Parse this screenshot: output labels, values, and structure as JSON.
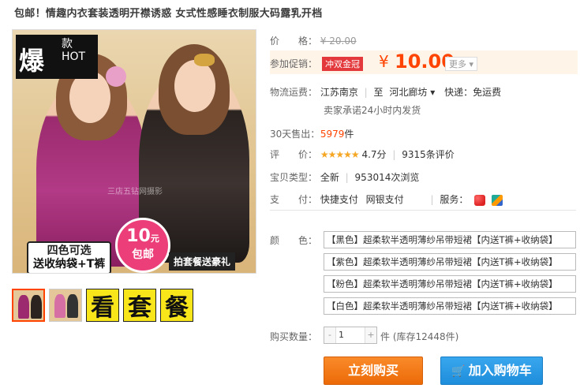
{
  "product": {
    "title": "包邮！情趣内衣套装透明开襟诱惑 女式性感睡衣制服大码露乳开档"
  },
  "image": {
    "hot_big": "爆",
    "hot_small_1": "款",
    "hot_small_2": "HOT",
    "banner_left_1": "四色可选",
    "banner_left_2": "送收纳袋+T裤",
    "circle_num": "10",
    "circle_unit": "元",
    "circle_text": "包邮",
    "banner_right": "拍套餐送豪礼",
    "watermark": "三店五钻网摄影"
  },
  "thumbs": {
    "words": [
      "看",
      "套",
      "餐"
    ]
  },
  "info": {
    "price_label": "价　　格：",
    "original_price": "¥ 20.00",
    "promo_label": "参加促销：",
    "promo_tag": "冲双金冠",
    "yen": "¥",
    "sale_price": "10.00",
    "more": "更多 ▾",
    "shipping_label": "物流运费：",
    "shipping_from": "江苏南京",
    "shipping_to_prefix": "至",
    "shipping_to": "河北廊坊 ▾",
    "shipping_fee": "快递：免运费",
    "shipping_note": "卖家承诺24小时内发货",
    "sold_label": "30天售出：",
    "sold_count": "5979",
    "sold_unit": "件",
    "rating_label": "评　　价：",
    "stars": "★★★★★",
    "rating": "4.7分",
    "reviews": "9315条评价",
    "type_label": "宝贝类型：",
    "type_value": "全新",
    "views": "953014次浏览",
    "pay_label": "支　　付：",
    "pay_1": "快捷支付",
    "pay_2": "网银支付",
    "service_label": "服务："
  },
  "options": {
    "color_label": "颜　　色：",
    "colors": [
      "【黑色】超柔软半透明薄纱吊带短裙【内送T裤+收纳袋】",
      "【紫色】超柔软半透明薄纱吊带短裙【内送T裤+收纳袋】",
      "【粉色】超柔软半透明薄纱吊带短裙【内送T裤+收纳袋】",
      "【白色】超柔软半透明薄纱吊带短裙【内送T裤+收纳袋】"
    ],
    "qty_label": "购买数量：",
    "qty_minus": "-",
    "qty_value": "1",
    "qty_plus": "+",
    "stock": "件 (库存12448件)"
  },
  "actions": {
    "buy": "立刻购买",
    "cart": "加入购物车",
    "cart_icon": "🛒"
  },
  "icons": {
    "service_1": "heart-icon",
    "service_2": "flag-icon"
  }
}
